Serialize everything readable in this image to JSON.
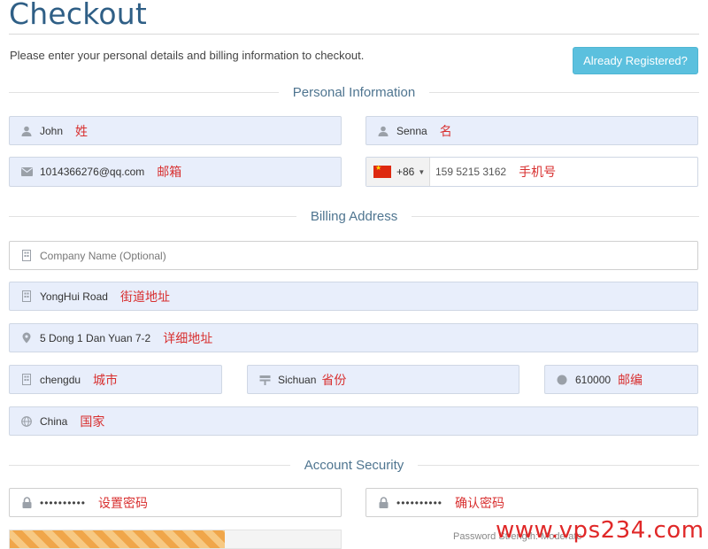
{
  "page": {
    "title": "Checkout",
    "intro": "Please enter your personal details and billing information to checkout.",
    "already_registered_label": "Already Registered?"
  },
  "sections": {
    "personal": "Personal Information",
    "billing": "Billing Address",
    "security": "Account Security"
  },
  "personal": {
    "first_name": {
      "value": "John",
      "note": "姓",
      "icon": "user-icon"
    },
    "last_name": {
      "value": "Senna",
      "note": "名",
      "icon": "user-icon"
    },
    "email": {
      "value": "1014366276@qq.com",
      "note": "邮箱",
      "icon": "envelope-icon"
    },
    "phone": {
      "country_code": "+86",
      "flag": "china-flag",
      "value": "159 5215 3162",
      "note": "手机号"
    }
  },
  "billing": {
    "company": {
      "placeholder": "Company Name (Optional)",
      "icon": "building-icon"
    },
    "address1": {
      "value": "YongHui Road",
      "note": "街道地址",
      "icon": "building-icon"
    },
    "address2": {
      "value": "5 Dong 1 Dan Yuan 7-2",
      "note": "详细地址",
      "icon": "map-marker-icon"
    },
    "city": {
      "value": "chengdu",
      "note": "城市",
      "icon": "building-icon"
    },
    "state": {
      "value": "Sichuan",
      "note": "省份",
      "icon": "signpost-icon"
    },
    "postcode": {
      "value": "610000",
      "note": "邮编",
      "icon": "circle-icon"
    },
    "country": {
      "value": "China",
      "note": "国家",
      "icon": "globe-icon"
    }
  },
  "security": {
    "password": {
      "value": "••••••••••",
      "note": "设置密码",
      "icon": "lock-icon"
    },
    "confirm": {
      "value": "••••••••••",
      "note": "确认密码",
      "icon": "lock-icon"
    },
    "strength_label": "Password Strength: Moderate",
    "strength_fraction": 0.65
  },
  "watermark": "www.vps234.com",
  "colors": {
    "accent": "#5bc0de",
    "title": "#2f5f86",
    "note": "#d83030",
    "field_bg": "#e8eefb"
  }
}
